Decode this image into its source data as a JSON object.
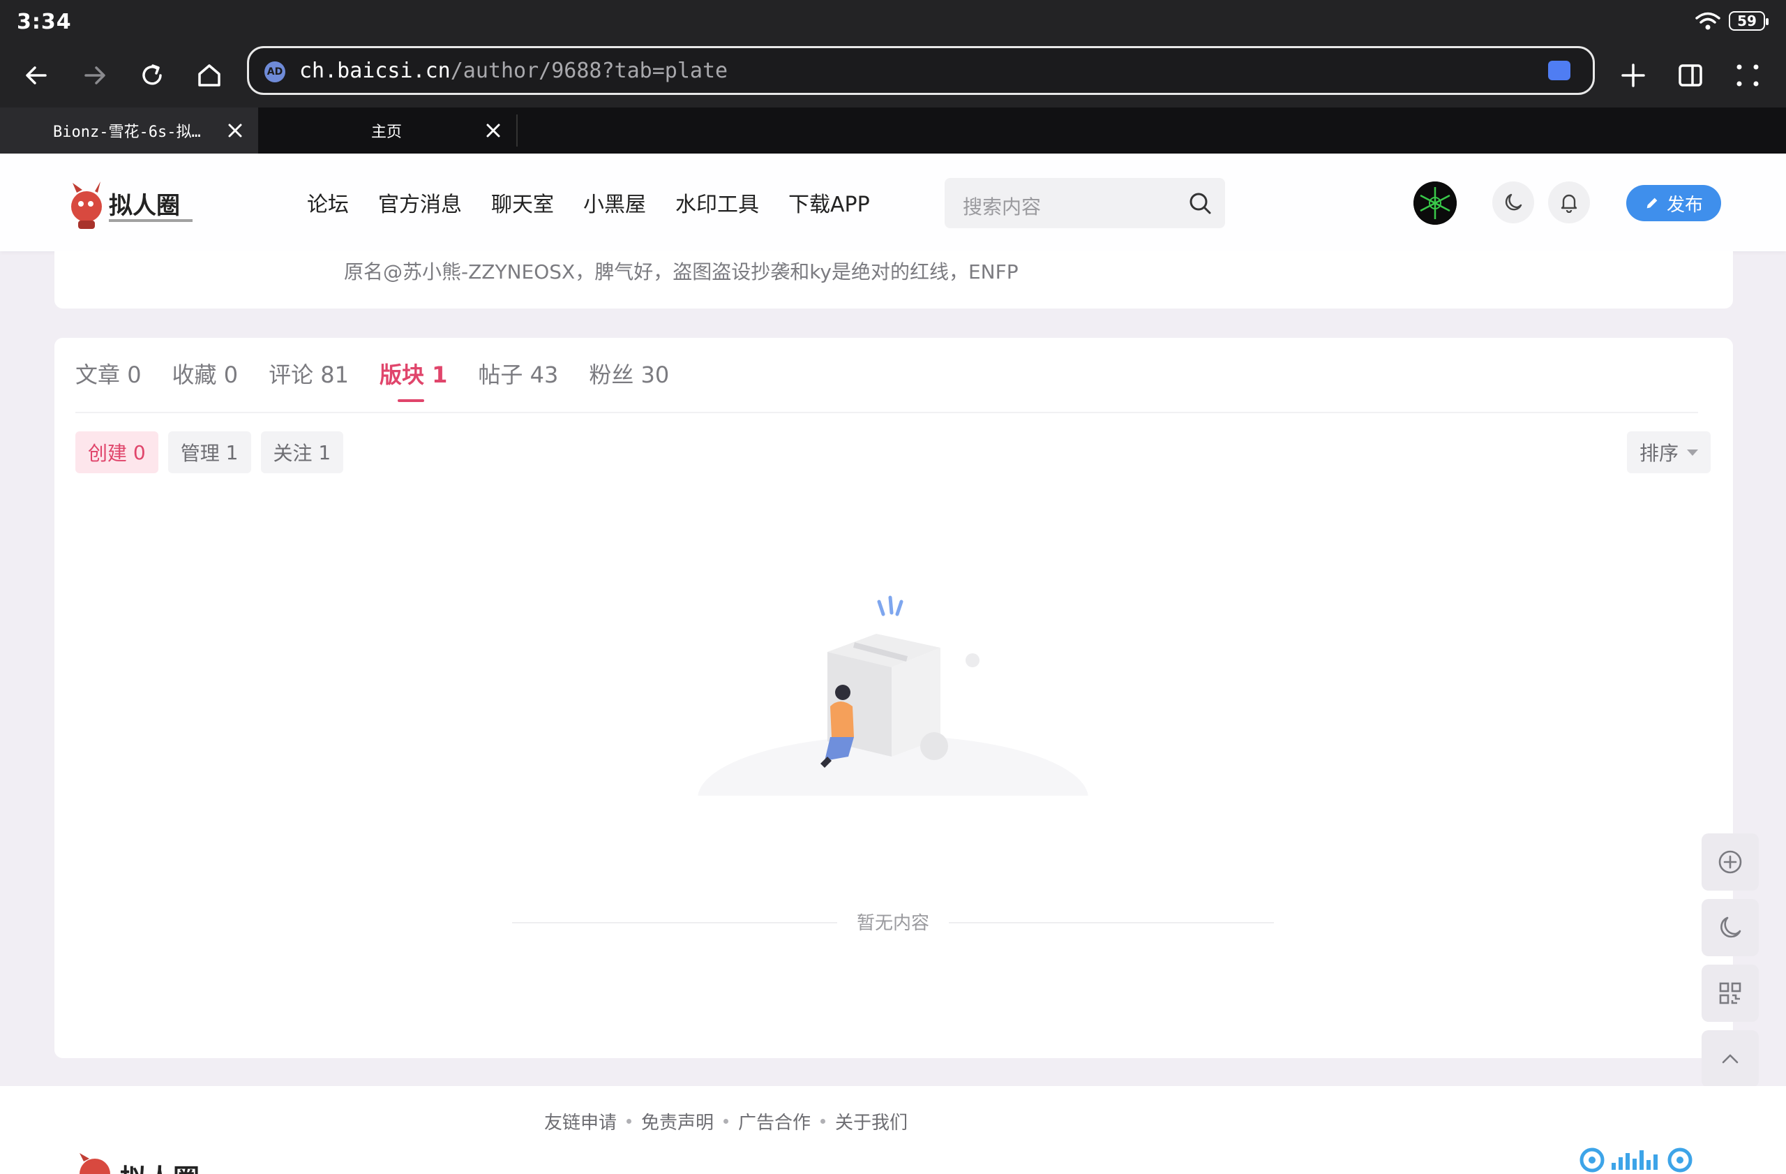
{
  "status_bar": {
    "time": "3:34",
    "battery": "59"
  },
  "browser": {
    "url_host": "ch.baicsi.cn",
    "url_path": "/author/9688?tab=plate",
    "url_badge": "AD",
    "tabs": [
      {
        "label": "Bionz-雪花-6s-拟…"
      },
      {
        "label": "主页"
      }
    ]
  },
  "site": {
    "logo_text": "拟人圈",
    "nav": [
      "论坛",
      "官方消息",
      "聊天室",
      "小黑屋",
      "水印工具",
      "下载APP"
    ],
    "search_placeholder": "搜索内容",
    "publish_label": "发布"
  },
  "profile": {
    "bio": "原名@苏小熊-ZZYNEOSX，脾气好，盗图盗设抄袭和ky是绝对的红线，ENFP",
    "tabs": [
      {
        "label": "文章",
        "count": "0"
      },
      {
        "label": "收藏",
        "count": "0"
      },
      {
        "label": "评论",
        "count": "81"
      },
      {
        "label": "版块",
        "count": "1"
      },
      {
        "label": "帖子",
        "count": "43"
      },
      {
        "label": "粉丝",
        "count": "30"
      }
    ],
    "active_tab": "版块",
    "subtabs": [
      {
        "label": "创建",
        "count": "0"
      },
      {
        "label": "管理",
        "count": "1"
      },
      {
        "label": "关注",
        "count": "1"
      }
    ],
    "active_subtab": "创建",
    "sort_label": "排序",
    "empty_text": "暂无内容"
  },
  "footer": {
    "links": [
      "友链申请",
      "免责声明",
      "广告合作",
      "关于我们"
    ]
  },
  "colors": {
    "accent": "#e0456b",
    "publish": "#3f8fec",
    "browser_chrome": "#232325"
  }
}
